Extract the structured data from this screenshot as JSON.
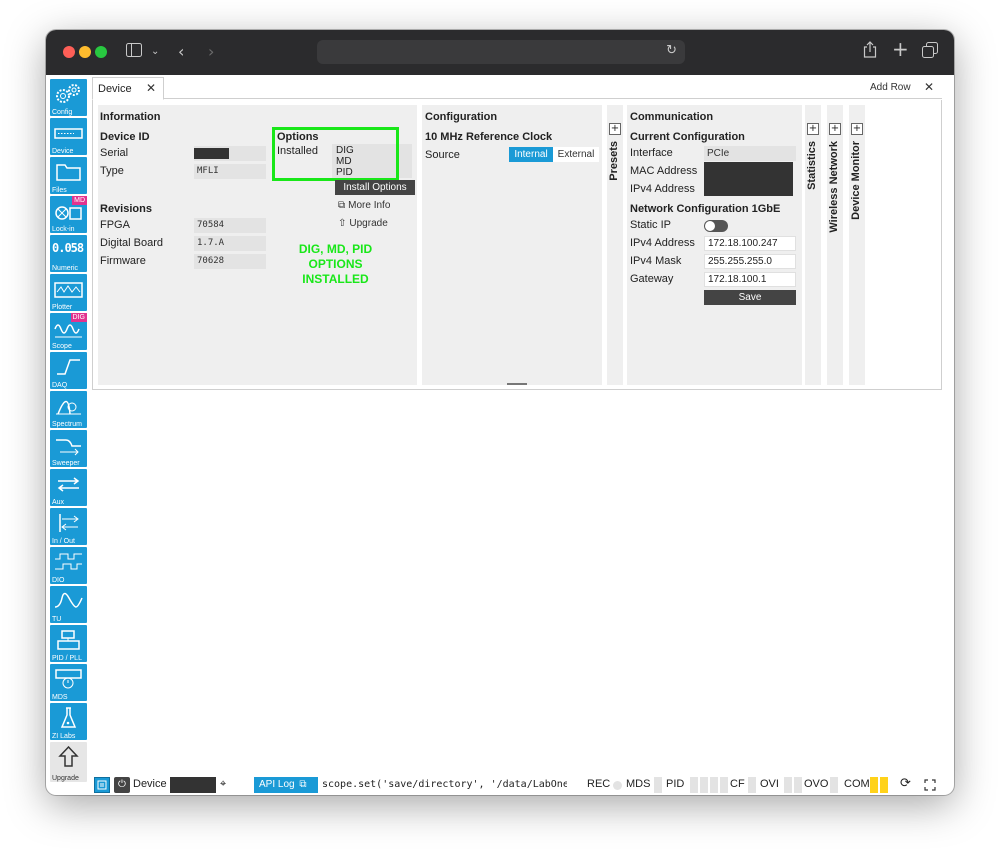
{
  "sidebar": {
    "items": [
      {
        "label": "Config",
        "icon": "gears-icon"
      },
      {
        "label": "Device",
        "icon": "device-icon"
      },
      {
        "label": "Files",
        "icon": "folder-icon"
      },
      {
        "label": "Lock-in",
        "icon": "lockin-icon",
        "badge": "MD"
      },
      {
        "label": "Numeric",
        "icon": "numeric-icon",
        "display": "0.058"
      },
      {
        "label": "Plotter",
        "icon": "plotter-icon"
      },
      {
        "label": "Scope",
        "icon": "scope-icon",
        "badge": "DIG"
      },
      {
        "label": "DAQ",
        "icon": "daq-icon"
      },
      {
        "label": "Spectrum",
        "icon": "spectrum-icon"
      },
      {
        "label": "Sweeper",
        "icon": "sweeper-icon"
      },
      {
        "label": "Aux",
        "icon": "aux-icon"
      },
      {
        "label": "In / Out",
        "icon": "inout-icon"
      },
      {
        "label": "DIO",
        "icon": "dio-icon"
      },
      {
        "label": "TU",
        "icon": "tu-icon"
      },
      {
        "label": "PID / PLL",
        "icon": "pid-icon"
      },
      {
        "label": "MDS",
        "icon": "mds-icon"
      },
      {
        "label": "ZI Labs",
        "icon": "flask-icon"
      },
      {
        "label": "Upgrade",
        "icon": "upgrade-icon"
      }
    ]
  },
  "tabs": {
    "active": "Device",
    "close": "✕",
    "add_row": "Add Row",
    "close_all": "✕"
  },
  "information": {
    "title": "Information",
    "device_id_title": "Device ID",
    "serial_label": "Serial",
    "type_label": "Type",
    "type_value": "MFLI",
    "revisions_title": "Revisions",
    "fpga_label": "FPGA",
    "fpga_value": "70584",
    "board_label": "Digital Board",
    "board_value": "1.7.A",
    "firmware_label": "Firmware",
    "firmware_value": "70628"
  },
  "options": {
    "title": "Options",
    "installed_label": "Installed",
    "installed": [
      "DIG",
      "MD",
      "PID"
    ],
    "install_button": "Install Options",
    "more_info": "More Info",
    "upgrade": "Upgrade",
    "annotation": [
      "DIG, MD, PID",
      "OPTIONS",
      "INSTALLED"
    ]
  },
  "configuration": {
    "title": "Configuration",
    "clock_title": "10 MHz Reference Clock",
    "source_label": "Source",
    "source_options": [
      "Internal",
      "External"
    ],
    "source_selected": "Internal"
  },
  "presets": {
    "label": "Presets",
    "plus": "+"
  },
  "communication": {
    "title": "Communication",
    "current_title": "Current Configuration",
    "interface_label": "Interface",
    "interface_value": "PCIe",
    "mac_label": "MAC Address",
    "ipv4_label": "IPv4 Address",
    "network_title": "Network Configuration 1GbE",
    "static_ip_label": "Static IP",
    "static_ip_on": false,
    "ipv4_field_label": "IPv4 Address",
    "ipv4_value": "172.18.100.247",
    "mask_label": "IPv4 Mask",
    "mask_value": "255.255.255.0",
    "gateway_label": "Gateway",
    "gateway_value": "172.18.100.1",
    "save_button": "Save"
  },
  "side_strips": [
    {
      "label": "Statistics",
      "plus": "+"
    },
    {
      "label": "Wireless Network",
      "plus": "+"
    },
    {
      "label": "Device Monitor",
      "plus": "+"
    }
  ],
  "statusbar": {
    "device_label": "Device",
    "api_log": "API Log",
    "command": "scope.set('save/directory', '/data/LabOne",
    "indicators": [
      "REC",
      "MDS",
      "PID",
      "CF",
      "OVI",
      "OVO",
      "COM"
    ],
    "com_color": "#ffd21a"
  },
  "colors": {
    "accent": "#1a9ad6",
    "annotation": "#19e719",
    "badge": "#e2338f"
  }
}
